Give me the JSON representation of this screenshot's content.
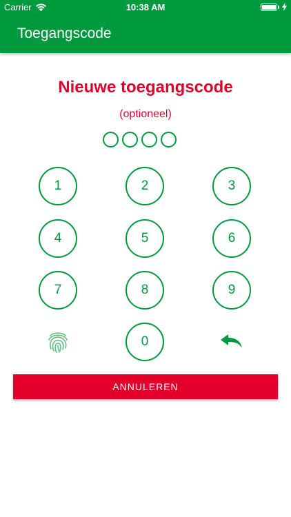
{
  "status_bar": {
    "carrier": "Carrier",
    "time": "10:38 AM",
    "wifi_icon": "wifi-icon",
    "battery_icon": "battery-icon",
    "charging_icon": "bolt-icon"
  },
  "app_bar": {
    "title": "Toegangscode"
  },
  "main": {
    "title": "Nieuwe toegangscode",
    "subtitle": "(optioneel)",
    "pin_length": 4,
    "pin_entered": 0
  },
  "keypad": {
    "keys": [
      "1",
      "2",
      "3",
      "4",
      "5",
      "6",
      "7",
      "8",
      "9",
      "0"
    ],
    "fingerprint_icon": "fingerprint-icon",
    "undo_icon": "undo-icon"
  },
  "actions": {
    "cancel_label": "ANNULEREN"
  },
  "colors": {
    "primary_green": "#009a3e",
    "accent_red": "#e4002b",
    "fingerprint_green": "#5bbf7d",
    "background": "#ffffff"
  }
}
